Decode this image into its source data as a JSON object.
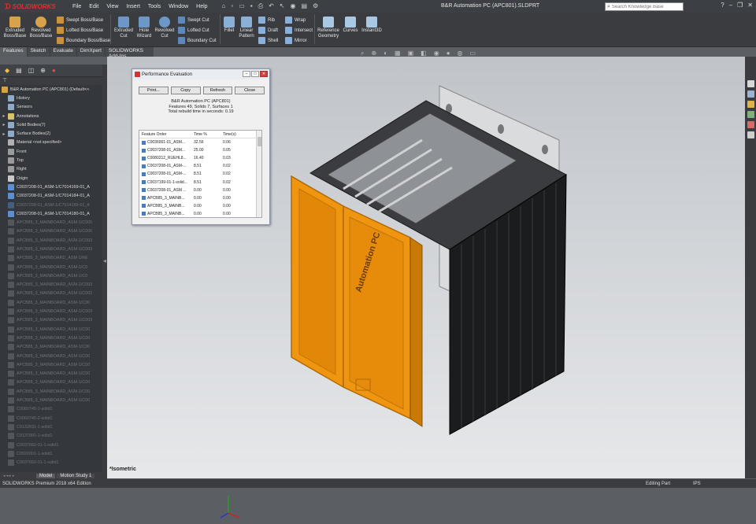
{
  "app": {
    "name": "SOLIDWORKS",
    "document_title": "B&R Automation PC (APC801).SLDPRT"
  },
  "menu": [
    "File",
    "Edit",
    "View",
    "Insert",
    "Tools",
    "Window",
    "Help"
  ],
  "search": {
    "placeholder": "Search Knowledge Base"
  },
  "ribbon": {
    "extruded_boss": "Extruded Boss/Base",
    "revolved_boss": "Revolved Boss/Base",
    "swept_boss": "Swept Boss/Base",
    "lofted_boss": "Lofted Boss/Base",
    "boundary_boss": "Boundary Boss/Base",
    "extruded_cut": "Extruded Cut",
    "hole_wizard": "Hole Wizard",
    "revolved_cut": "Revolved Cut",
    "swept_cut": "Swept Cut",
    "lofted_cut": "Lofted Cut",
    "boundary_cut": "Boundary Cut",
    "fillet": "Fillet",
    "linear_pattern": "Linear Pattern",
    "rib": "Rib",
    "draft": "Draft",
    "shell": "Shell",
    "wrap": "Wrap",
    "intersect": "Intersect",
    "mirror": "Mirror",
    "reference_geometry": "Reference Geometry",
    "curves": "Curves",
    "instant3d": "Instant3D"
  },
  "cm_tabs": [
    "Features",
    "Sketch",
    "Evaluate",
    "DimXpert",
    "SOLIDWORKS Add-Ins"
  ],
  "tree": {
    "root": "B&R Automation PC (APC801) (Default<<",
    "items": [
      {
        "label": "History",
        "icon": "history-icon",
        "expand": false,
        "sup": false
      },
      {
        "label": "Sensors",
        "icon": "sensor-icon",
        "expand": false,
        "sup": false
      },
      {
        "label": "Annotations",
        "icon": "annotation-icon",
        "expand": true,
        "sup": false
      },
      {
        "label": "Solid Bodies(7)",
        "icon": "solid-bodies-icon",
        "expand": true,
        "sup": false
      },
      {
        "label": "Surface Bodies(2)",
        "icon": "surface-bodies-icon",
        "expand": true,
        "sup": false
      },
      {
        "label": "Material <not specified>",
        "icon": "material-icon",
        "expand": false,
        "sup": false
      },
      {
        "label": "Front",
        "icon": "plane-icon",
        "expand": false,
        "sup": false
      },
      {
        "label": "Top",
        "icon": "plane-icon",
        "expand": false,
        "sup": false
      },
      {
        "label": "Right",
        "icon": "plane-icon",
        "expand": false,
        "sup": false
      },
      {
        "label": "Origin",
        "icon": "origin-icon",
        "expand": false,
        "sup": false
      },
      {
        "label": "C0037208-01_ASM-1/C7014169-01_A",
        "icon": "imported-body-icon",
        "expand": false,
        "sup": false
      },
      {
        "label": "C0037208-01_ASM-1/C7014184-01_A",
        "icon": "imported-body-icon",
        "expand": false,
        "sup": false
      },
      {
        "label": "C0037208-01_ASM-1/C7014189-01_A",
        "icon": "imported-body-icon",
        "expand": false,
        "sup": true
      },
      {
        "label": "C0037208-01_ASM-1/C7014180-01_A",
        "icon": "imported-body-icon",
        "expand": false,
        "sup": false
      },
      {
        "label": "APCB85_3_MAINBOARD_ASM-1/C005",
        "icon": "body-icon",
        "expand": false,
        "sup": true
      },
      {
        "label": "APCB85_3_MAINBOARD_ASM-1/C006",
        "icon": "body-icon",
        "expand": false,
        "sup": true
      },
      {
        "label": "APCB85_3_MAINBOARD_ASM-1/C003",
        "icon": "body-icon",
        "expand": false,
        "sup": true
      },
      {
        "label": "APCB85_3_MAINBOARD_ASM-1/C003",
        "icon": "body-icon",
        "expand": false,
        "sup": true
      },
      {
        "label": "APCB85_3_MAINBOARD_ASM-1/RE",
        "icon": "body-icon",
        "expand": false,
        "sup": true
      },
      {
        "label": "APCB85_3_MAINBOARD_ASM-1/C0",
        "icon": "body-icon",
        "expand": false,
        "sup": true
      },
      {
        "label": "APCB85_3_MAINBOARD_ASM-1/C0",
        "icon": "body-icon",
        "expand": false,
        "sup": true
      },
      {
        "label": "APCB85_3_MAINBOARD_ASM-1/C003",
        "icon": "body-icon",
        "expand": false,
        "sup": true
      },
      {
        "label": "APCB85_3_MAINBOARD_ASM-1/C002",
        "icon": "body-icon",
        "expand": false,
        "sup": true
      },
      {
        "label": "APCB85_3_MAINBOARD_ASM-1/C00",
        "icon": "body-icon",
        "expand": false,
        "sup": true
      },
      {
        "label": "APCB85_3_MAINBOARD_ASM-1/C003",
        "icon": "body-icon",
        "expand": false,
        "sup": true
      },
      {
        "label": "APCB85_3_MAINBOARD_ASM-1/C003",
        "icon": "body-icon",
        "expand": false,
        "sup": true
      },
      {
        "label": "APCB85_3_MAINBOARD_ASM-1/C00",
        "icon": "body-icon",
        "expand": false,
        "sup": true
      },
      {
        "label": "APCB85_3_MAINBOARD_ASM-1/C00",
        "icon": "body-icon",
        "expand": false,
        "sup": true
      },
      {
        "label": "APCB85_3_MAINBOARD_ASM-1/C00",
        "icon": "body-icon",
        "expand": false,
        "sup": true
      },
      {
        "label": "APCB85_3_MAINBOARD_ASM-1/C00",
        "icon": "body-icon",
        "expand": false,
        "sup": true
      },
      {
        "label": "APCB85_3_MAINBOARD_ASM-1/C00",
        "icon": "body-icon",
        "expand": false,
        "sup": true
      },
      {
        "label": "APCB85_3_MAINBOARD_ASM-1/C00",
        "icon": "body-icon",
        "expand": false,
        "sup": true
      },
      {
        "label": "APCB85_3_MAINBOARD_ASM-1/C00",
        "icon": "body-icon",
        "expand": false,
        "sup": true
      },
      {
        "label": "APCB85_3_MAINBOARD_ASM-1/C00",
        "icon": "body-icon",
        "expand": false,
        "sup": true
      },
      {
        "label": "APCB85_3_MAINBOARD_ASM-1/C00",
        "icon": "body-icon",
        "expand": false,
        "sup": true
      },
      {
        "label": "C0060745-1-solid1",
        "icon": "body-icon",
        "expand": false,
        "sup": true
      },
      {
        "label": "C0060745-2-solid1",
        "icon": "body-icon",
        "expand": false,
        "sup": true
      },
      {
        "label": "C0132831-1-solid1",
        "icon": "body-icon",
        "expand": false,
        "sup": true
      },
      {
        "label": "C0137991-1-solid1",
        "icon": "body-icon",
        "expand": false,
        "sup": true
      },
      {
        "label": "C0037992-01-1-solid1",
        "icon": "body-icon",
        "expand": false,
        "sup": true
      },
      {
        "label": "C0020001-1-solid1",
        "icon": "body-icon",
        "expand": false,
        "sup": true
      },
      {
        "label": "C0037992-01-1-solid1",
        "icon": "body-icon",
        "expand": false,
        "sup": true
      }
    ]
  },
  "dialog": {
    "title": "Performance Evaluation",
    "buttons": {
      "print": "Print...",
      "copy": "Copy",
      "refresh": "Refresh",
      "close": "Close"
    },
    "info": {
      "name": "B&R Automation PC (APC801)",
      "counts": "Features 49, Solids 7, Surfaces 1",
      "rebuild": "Total rebuild time in seconds: 0.19"
    },
    "columns": {
      "order": "Feature Order",
      "time": "Time %",
      "time_s": "Time(s)"
    },
    "rows": [
      {
        "name": "C0036001-01_ASM...",
        "pct": "32.56",
        "sec": "0.06"
      },
      {
        "name": "C0037208-01_ASM...",
        "pct": "25.00",
        "sec": "0.05"
      },
      {
        "name": "C0080212_RUEHL8...",
        "pct": "16.40",
        "sec": "0.03"
      },
      {
        "name": "C0037208-01_ASM-...",
        "pct": "8.51",
        "sec": "0.02"
      },
      {
        "name": "C0037208-01_ASM-...",
        "pct": "8.51",
        "sec": "0.02"
      },
      {
        "name": "C0037199-01-1-solid...",
        "pct": "8.51",
        "sec": "0.02"
      },
      {
        "name": "C0037208-01_ASM ...",
        "pct": "0.00",
        "sec": "0.00"
      },
      {
        "name": "APCB85_3_MAINB...",
        "pct": "0.00",
        "sec": "0.00"
      },
      {
        "name": "APCB85_3_MAINB...",
        "pct": "0.00",
        "sec": "0.00"
      },
      {
        "name": "APCB85_3_MAINB...",
        "pct": "0.00",
        "sec": "0.00"
      }
    ]
  },
  "model_label": "Automation PC",
  "view_label": "*Isometric",
  "bottom_tabs": [
    "Model",
    "Motion Study 1"
  ],
  "status": {
    "edition": "SOLIDWORKS Premium 2018 x64 Edition",
    "mode": "Editing Part",
    "units": "IPS"
  },
  "colors": {
    "accent_orange": "#f0950f",
    "chassis": "#1b1c1e",
    "background_top": "#c0c4c9",
    "selection": "#2b5b87"
  }
}
